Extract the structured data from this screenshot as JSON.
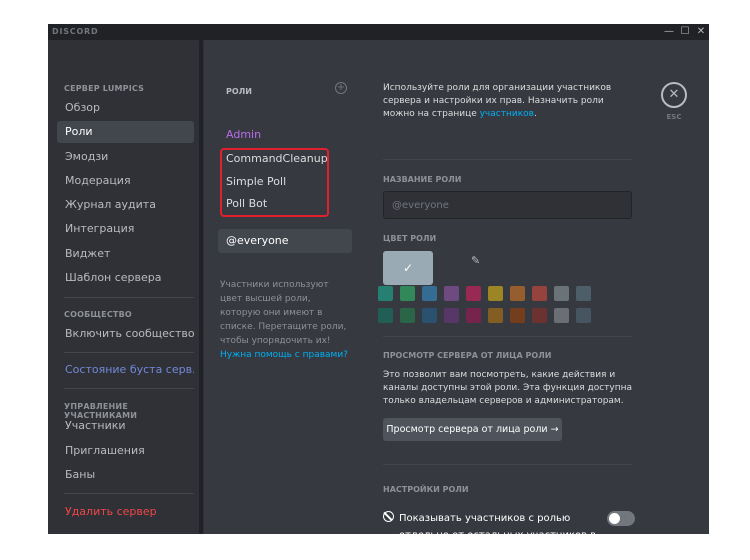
{
  "titlebar": {
    "app_name": "DISCORD",
    "minimize_glyph": "—",
    "maximize_glyph": "☐",
    "close_glyph": "✕"
  },
  "sidebar": {
    "server_heading": "СЕРВЕР LUMPICS",
    "items": [
      {
        "label": "Обзор"
      },
      {
        "label": "Роли",
        "selected": true
      },
      {
        "label": "Эмодзи"
      },
      {
        "label": "Модерация"
      },
      {
        "label": "Журнал аудита"
      },
      {
        "label": "Интеграция"
      },
      {
        "label": "Виджет"
      },
      {
        "label": "Шаблон сервера"
      }
    ],
    "community_heading": "СООБЩЕСТВО",
    "enable_community": "Включить сообщество",
    "boost_status": "Состояние буста серв...",
    "members_heading": "УПРАВЛЕНИЕ УЧАСТНИКАМИ",
    "member_items": [
      {
        "label": "Участники"
      },
      {
        "label": "Приглашения"
      },
      {
        "label": "Баны"
      }
    ],
    "delete_server": "Удалить сервер"
  },
  "roles": {
    "heading": "РОЛИ",
    "add_glyph": "+",
    "list": [
      {
        "name": "Admin",
        "color": "#b96ce8"
      },
      {
        "name": "CommandCleanup"
      },
      {
        "name": "Simple Poll"
      },
      {
        "name": "Poll Bot"
      }
    ],
    "everyone": "@everyone",
    "description": "Участники используют цвет высшей роли, которую они имеют в списке. Перетащите роли, чтобы упорядочить их!",
    "help_link": "Нужна помощь с правами?"
  },
  "main": {
    "intro_text": "Используйте роли для организации участников сервера и настройки их прав. Назначить роли можно на странице",
    "intro_link": "участников",
    "intro_end": ".",
    "close_glyph": "✕",
    "esc_label": "ESC",
    "role_name_label": "НАЗВАНИЕ РОЛИ",
    "role_name_value": "@everyone",
    "role_color_label": "ЦВЕТ РОЛИ",
    "default_color_check": "✓",
    "custom_color_icon": "✎",
    "swatch_colors": [
      "#1abc9c",
      "#2ecc71",
      "#3498db",
      "#9b59b6",
      "#e91e63",
      "#f1c40f",
      "#e67e22",
      "#e74c3c",
      "#95a5a6",
      "#607d8b",
      "#11806a",
      "#1f8b4c",
      "#206694",
      "#71368a",
      "#ad1457",
      "#c27c0e",
      "#a84300",
      "#992d22",
      "#979c9f",
      "#546e7a"
    ],
    "view_as_role_label": "ПРОСМОТР СЕРВЕРА ОТ ЛИЦА РОЛИ",
    "view_as_role_desc": "Это позволит вам посмотреть, какие действия и каналы доступны этой роли. Эта функция доступна только владельцам серверов и администраторам.",
    "view_as_role_button": "Просмотр сервера от лица роли →",
    "role_settings_label": "НАСТРОЙКИ РОЛИ",
    "hoist_toggle_label": "Показывать участников с ролью отдельно от остальных участников в сети",
    "hoist_enabled": false
  },
  "colors": {
    "highlight_box": "#e0202f",
    "link": "#00b0f4",
    "danger": "#f04747",
    "boost": "#7289da"
  }
}
